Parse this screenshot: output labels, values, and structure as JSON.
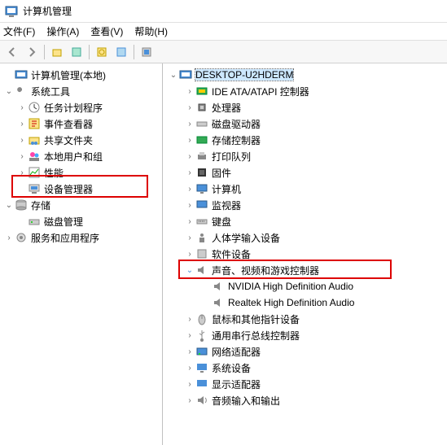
{
  "window": {
    "title": "计算机管理"
  },
  "menu": {
    "file": "文件(F)",
    "action": "操作(A)",
    "view": "查看(V)",
    "help": "帮助(H)"
  },
  "left_tree": {
    "root": "计算机管理(本地)",
    "system_tools": "系统工具",
    "task_scheduler": "任务计划程序",
    "event_viewer": "事件查看器",
    "shared_folders": "共享文件夹",
    "local_users": "本地用户和组",
    "performance": "性能",
    "device_manager": "设备管理器",
    "storage": "存储",
    "disk_management": "磁盘管理",
    "services": "服务和应用程序"
  },
  "right_tree": {
    "computer": "DESKTOP-U2HDERM",
    "ide": "IDE ATA/ATAPI 控制器",
    "cpu": "处理器",
    "disk_drives": "磁盘驱动器",
    "storage_ctrl": "存储控制器",
    "print_queues": "打印队列",
    "firmware": "固件",
    "computer_cat": "计算机",
    "monitors": "监视器",
    "keyboards": "键盘",
    "hid": "人体学输入设备",
    "software": "软件设备",
    "sound": "声音、视频和游戏控制器",
    "nvidia_audio": "NVIDIA High Definition Audio",
    "realtek_audio": "Realtek High Definition Audio",
    "mouse": "鼠标和其他指针设备",
    "usb": "通用串行总线控制器",
    "network": "网络适配器",
    "system_devices": "系统设备",
    "display": "显示适配器",
    "audio_io": "音频输入和输出"
  }
}
